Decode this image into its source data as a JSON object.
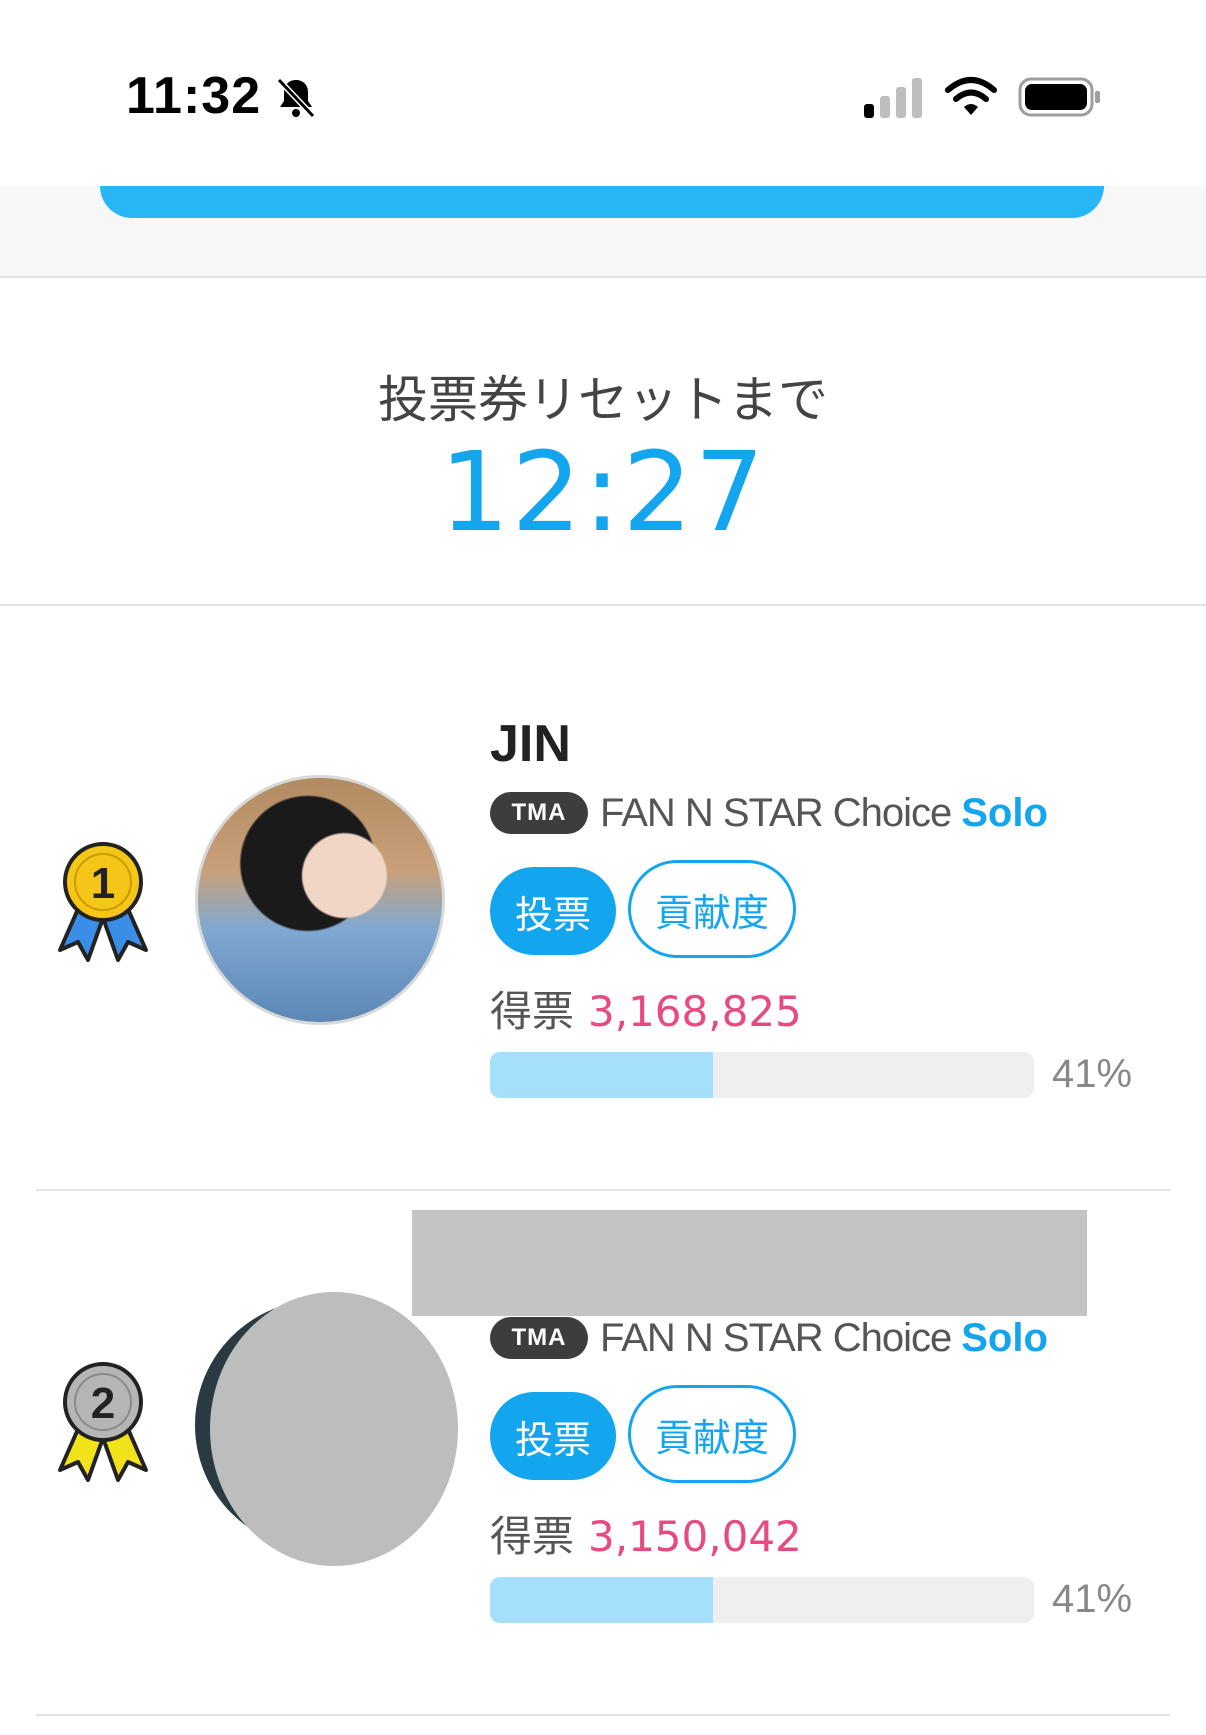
{
  "status_bar": {
    "time": "11:32",
    "icons": [
      "bell-slash-icon",
      "cellular-signal-icon",
      "wifi-icon",
      "battery-icon"
    ]
  },
  "countdown": {
    "label": "投票券リセットまで",
    "time": "12:27"
  },
  "entries": [
    {
      "rank": "1",
      "medal": "gold-medal-icon",
      "name": "JIN",
      "badge": "TMA",
      "category": "FAN N STAR Choice",
      "category_accent": "Solo",
      "vote_button": "投票",
      "contribution_button": "貢献度",
      "votes_label": "得票",
      "votes": "3,168,825",
      "progress_fraction": 0.41,
      "percent": "41%"
    },
    {
      "rank": "2",
      "medal": "silver-medal-icon",
      "name": "",
      "badge": "TMA",
      "category": "FAN N STAR Choice",
      "category_accent": "Solo",
      "vote_button": "投票",
      "contribution_button": "貢献度",
      "votes_label": "得票",
      "votes": "3,150,042",
      "progress_fraction": 0.41,
      "percent": "41%"
    }
  ],
  "colors": {
    "accent": "#14a5ef",
    "votes": "#e84a7f",
    "progress_fill": "#a6dffb"
  }
}
